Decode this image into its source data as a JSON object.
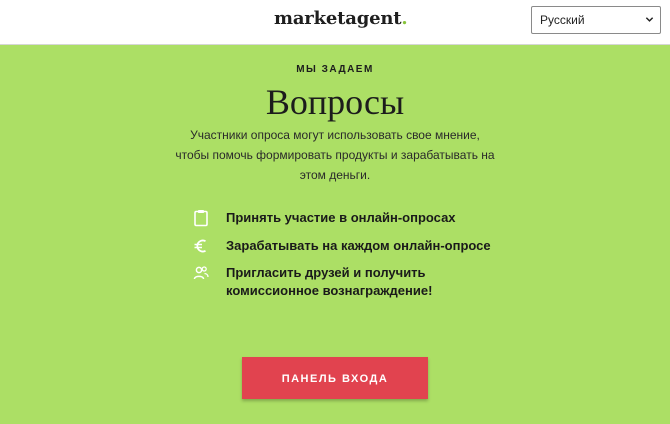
{
  "header": {
    "logo_text": "marketagent",
    "logo_dot": ".",
    "language_selected": "Русский"
  },
  "hero": {
    "kicker": "МЫ ЗАДАЕМ",
    "title": "Вопросы",
    "description": "Участники опроса могут использовать свое мнение, чтобы помочь формировать продукты и зарабатывать на этом деньги.",
    "features": [
      {
        "icon": "clipboard-icon",
        "text": "Принять участие в онлайн-опросах"
      },
      {
        "icon": "euro-icon",
        "text": "Зарабатывать на каждом онлайн-опросе"
      },
      {
        "icon": "users-icon",
        "text": "Пригласить друзей и получить комиссионное вознаграждение!"
      }
    ],
    "cta_label": "ПАНЕЛЬ ВХОДА"
  },
  "colors": {
    "hero_background": "#acdf65",
    "cta_background": "#e1434f",
    "logo_dot": "#86c33a"
  }
}
